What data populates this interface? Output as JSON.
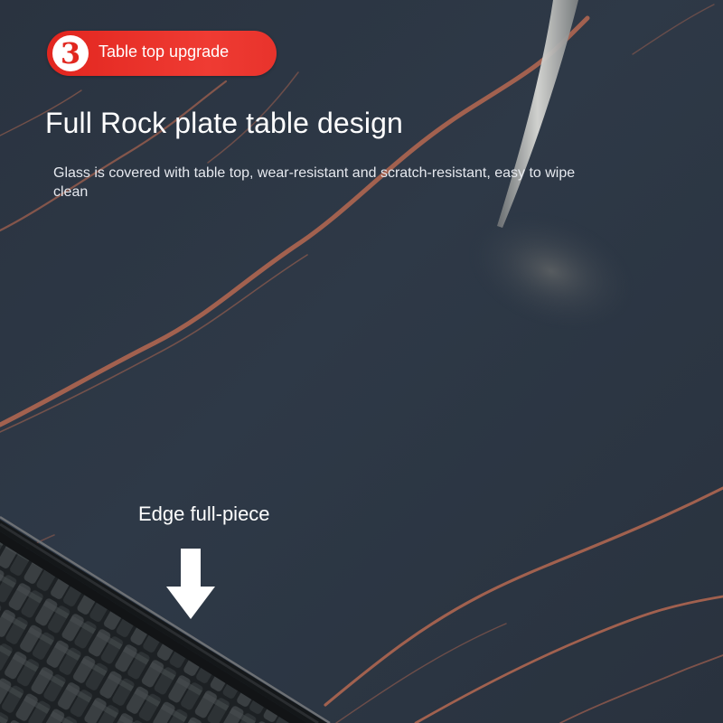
{
  "badge": {
    "number": "3",
    "label": "Table top upgrade"
  },
  "headline": "Full Rock plate table design",
  "subtext": "Glass is covered with table top, wear-resistant and scratch-resistant, easy to wipe clean",
  "edge_label": "Edge full-piece",
  "icons": {
    "step_badge": "number-3-circle-icon",
    "pointer": "down-arrow-icon"
  },
  "colors": {
    "badge_red": "#e2261f",
    "stone_dark": "#2b3543",
    "vein_copper": "#b86a52",
    "text_white": "#ffffff"
  }
}
